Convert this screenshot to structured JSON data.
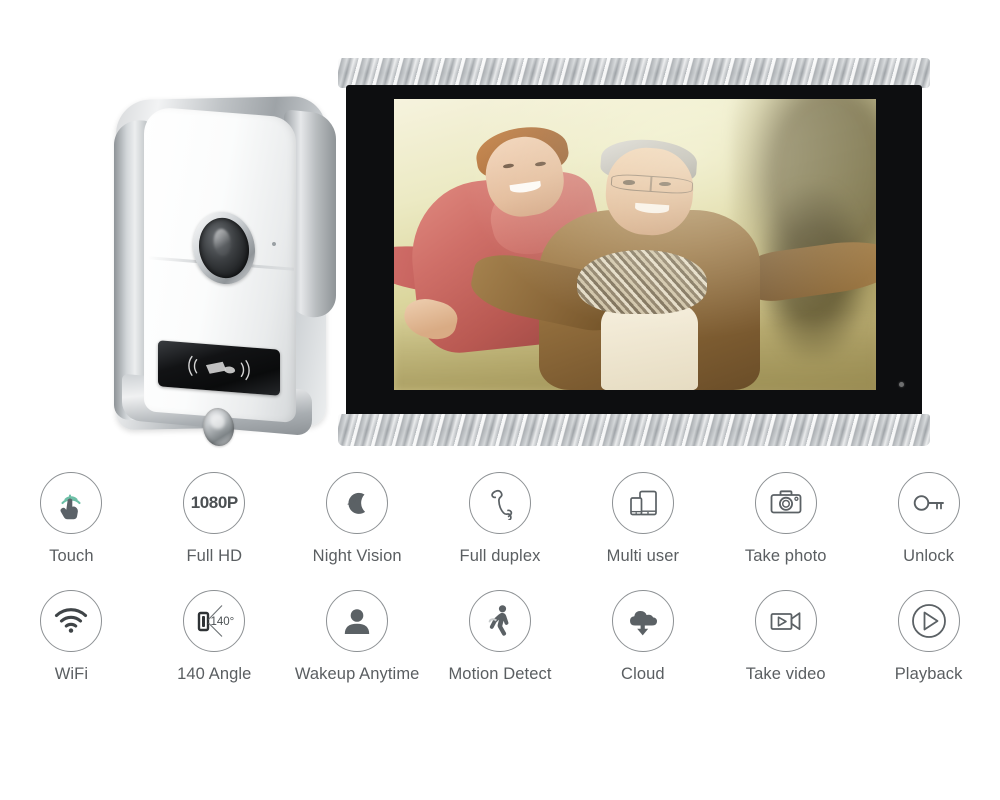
{
  "background_color": "#ffffff",
  "devices": {
    "doorbell": {
      "name": "outdoor-door-station",
      "parts": {
        "camera_lens": "camera-lens",
        "microphone": "microphone-hole",
        "rfid_panel": "rfid-card-reader",
        "call_button": "doorbell-call-button"
      }
    },
    "monitor": {
      "name": "indoor-touchscreen-monitor",
      "trim_color": "#b9bdc0",
      "bezel_color": "#0d0e10",
      "led_indicator": "power-led",
      "screen_content": "Smiling elderly couple outdoors with arms outstretched, warm bokeh park background"
    }
  },
  "features": {
    "row1": [
      {
        "id": "touch",
        "icon": "touch-gesture-icon",
        "label": "Touch",
        "accent": "#6cbfa6"
      },
      {
        "id": "full-hd",
        "icon": "1080p-text-icon",
        "label": "Full HD",
        "badge": "1080P"
      },
      {
        "id": "night-vision",
        "icon": "moon-stars-icon",
        "label": "Night Vision"
      },
      {
        "id": "full-duplex",
        "icon": "telephone-handset-icon",
        "label": "Full duplex"
      },
      {
        "id": "multi-user",
        "icon": "tablet-phone-icon",
        "label": "Multi user"
      },
      {
        "id": "take-photo",
        "icon": "camera-icon",
        "label": "Take photo"
      },
      {
        "id": "unlock",
        "icon": "key-icon",
        "label": "Unlock"
      }
    ],
    "row2": [
      {
        "id": "wifi",
        "icon": "wifi-icon",
        "label": "WiFi"
      },
      {
        "id": "angle",
        "icon": "viewing-angle-icon",
        "label": "140 Angle",
        "badge": "140°"
      },
      {
        "id": "wakeup",
        "icon": "person-silhouette-icon",
        "label": "Wakeup Anytime"
      },
      {
        "id": "motion-detect",
        "icon": "walking-person-icon",
        "label": "Motion Detect"
      },
      {
        "id": "cloud",
        "icon": "cloud-download-icon",
        "label": "Cloud"
      },
      {
        "id": "take-video",
        "icon": "video-camera-icon",
        "label": "Take video"
      },
      {
        "id": "playback",
        "icon": "play-circle-icon",
        "label": "Playback"
      }
    ]
  }
}
